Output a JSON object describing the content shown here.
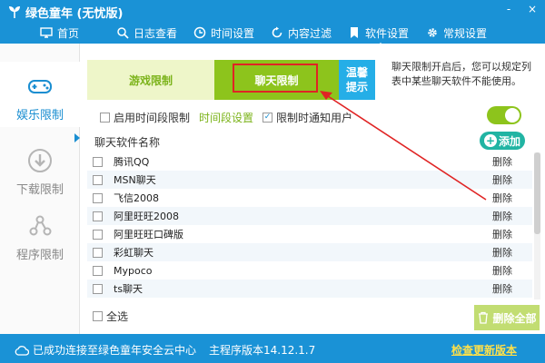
{
  "app": {
    "title": "绿色童年 (无忧版)",
    "window_controls": [
      "-",
      "×"
    ]
  },
  "nav": {
    "items": [
      {
        "label": "首页",
        "icon": "monitor-icon"
      },
      {
        "label": "日志查看",
        "icon": "search-icon"
      },
      {
        "label": "时间设置",
        "icon": "clock-icon"
      },
      {
        "label": "内容过滤",
        "icon": "refresh-icon"
      },
      {
        "label": "软件设置",
        "icon": "bookmark-icon"
      },
      {
        "label": "常规设置",
        "icon": "gear-icon"
      }
    ],
    "active": "软件设置"
  },
  "sidebar": {
    "items": [
      {
        "label": "娱乐限制",
        "icon": "gamepad-icon",
        "active": true
      },
      {
        "label": "下载限制",
        "icon": "download-icon",
        "active": false
      },
      {
        "label": "程序限制",
        "icon": "share-icon",
        "active": false
      }
    ]
  },
  "tabs": {
    "game_label": "游戏限制",
    "chat_label": "聊天限制",
    "active": "聊天限制"
  },
  "tip": {
    "title_line1": "温馨",
    "title_line2": "提示",
    "text": "聊天限制开启后，您可以规定列表中某些聊天软件不能使用。"
  },
  "options": {
    "timerange_label": "启用时间段限制",
    "timerange_checked": false,
    "timeset_label": "时间段设置",
    "notify_label": "限制时通知用户",
    "notify_checked": true,
    "toggle_on": true
  },
  "list": {
    "header": "聊天软件名称",
    "add_label": "添加",
    "delete_label": "删除",
    "rows": [
      "腾讯QQ",
      "MSN聊天",
      "飞信2008",
      "阿里旺旺2008",
      "阿里旺旺口碑版",
      "彩虹聊天",
      "Mypoco",
      "ts聊天"
    ]
  },
  "footer": {
    "select_all_label": "全选",
    "delete_all_label": "删除全部"
  },
  "status": {
    "connection": "已成功连接至绿色童年安全云中心",
    "version": "主程序版本14.12.1.7",
    "update_link": "检查更新版本"
  },
  "colors": {
    "primary_blue": "#1a92d6",
    "accent_green": "#8dc41c",
    "highlight_red": "#e02424",
    "update_yellow": "#ffe04a"
  }
}
